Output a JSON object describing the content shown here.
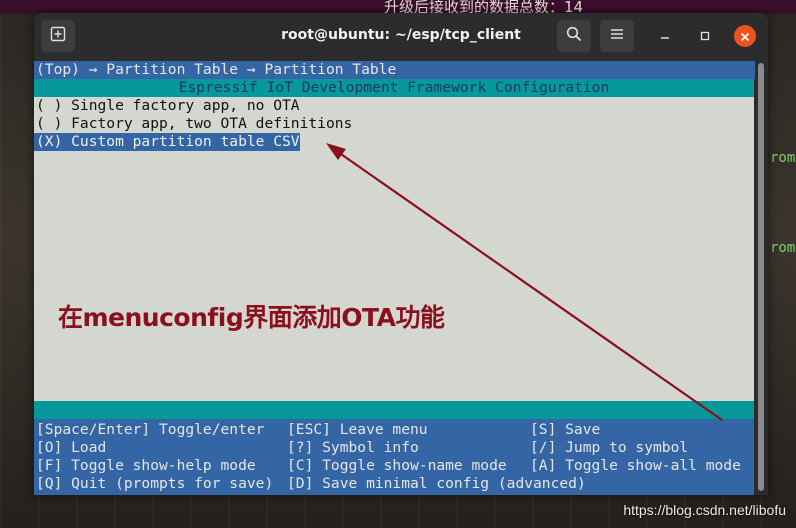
{
  "background": {
    "top_text": "升级后接收到的数据总数：14",
    "side_text_1": "rom",
    "side_text_2": "rom"
  },
  "window": {
    "title": "root@ubuntu: ~/esp/tcp_client"
  },
  "menuconfig": {
    "breadcrumb": "(Top) → Partition Table → Partition Table",
    "header": "Espressif IoT Development Framework Configuration",
    "options": [
      "( ) Single factory app, no OTA",
      "( ) Factory app, two OTA definitions",
      "(X) Custom partition table CSV"
    ],
    "help": [
      [
        "[Space/Enter] Toggle/enter",
        "[ESC] Leave menu",
        "[S] Save"
      ],
      [
        "[O] Load",
        "[?] Symbol info",
        "[/] Jump to symbol"
      ],
      [
        "[F] Toggle show-help mode",
        "[C] Toggle show-name mode",
        "[A] Toggle show-all mode"
      ],
      [
        "[Q] Quit (prompts for save)",
        "[D] Save minimal config (advanced)",
        ""
      ]
    ]
  },
  "annotation": {
    "text": "在menuconfig界面添加OTA功能",
    "color": "#8b0f1c"
  },
  "watermark": "https://blog.csdn.net/libofu",
  "colors": {
    "term_blue": "#3465a4",
    "term_cyan": "#06989a",
    "term_grey": "#d3d7cf",
    "close_orange": "#e95420"
  },
  "icons": {
    "new_tab": "new-tab-icon",
    "search": "search-icon",
    "menu": "hamburger-menu-icon",
    "minimize": "minimize-icon",
    "maximize": "maximize-icon",
    "close": "close-icon"
  }
}
